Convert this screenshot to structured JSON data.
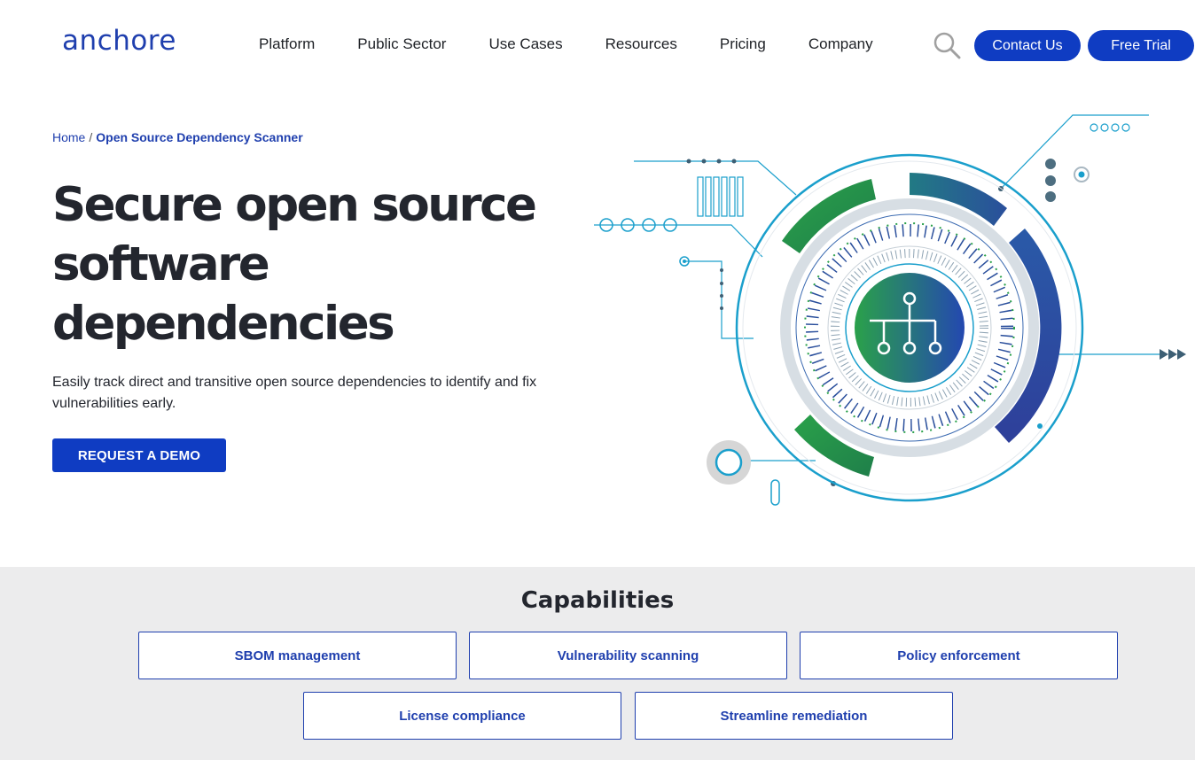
{
  "header": {
    "logo": "anchore",
    "nav": [
      "Platform",
      "Public Sector",
      "Use Cases",
      "Resources",
      "Pricing",
      "Company"
    ],
    "contact_label": "Contact Us",
    "trial_label": "Free Trial"
  },
  "breadcrumb": {
    "home": "Home",
    "separator": "/",
    "current": "Open Source Dependency Scanner"
  },
  "hero": {
    "title_line1": "Secure open source",
    "title_line2": "software",
    "title_line3": "dependencies",
    "subtitle": "Easily track direct and transitive open source dependencies to identify and fix vulnerabilities early.",
    "cta_label": "REQUEST A DEMO"
  },
  "capabilities": {
    "title": "Capabilities",
    "items": [
      "SBOM management",
      "Vulnerability scanning",
      "Policy enforcement",
      "License compliance",
      "Streamline remediation"
    ]
  },
  "colors": {
    "brand_blue": "#0f3cc2",
    "teal": "#1a9fcc",
    "green": "#2aa14a",
    "gray_bg": "#ececed"
  },
  "icons": [
    "search-icon",
    "hierarchy-icon"
  ]
}
